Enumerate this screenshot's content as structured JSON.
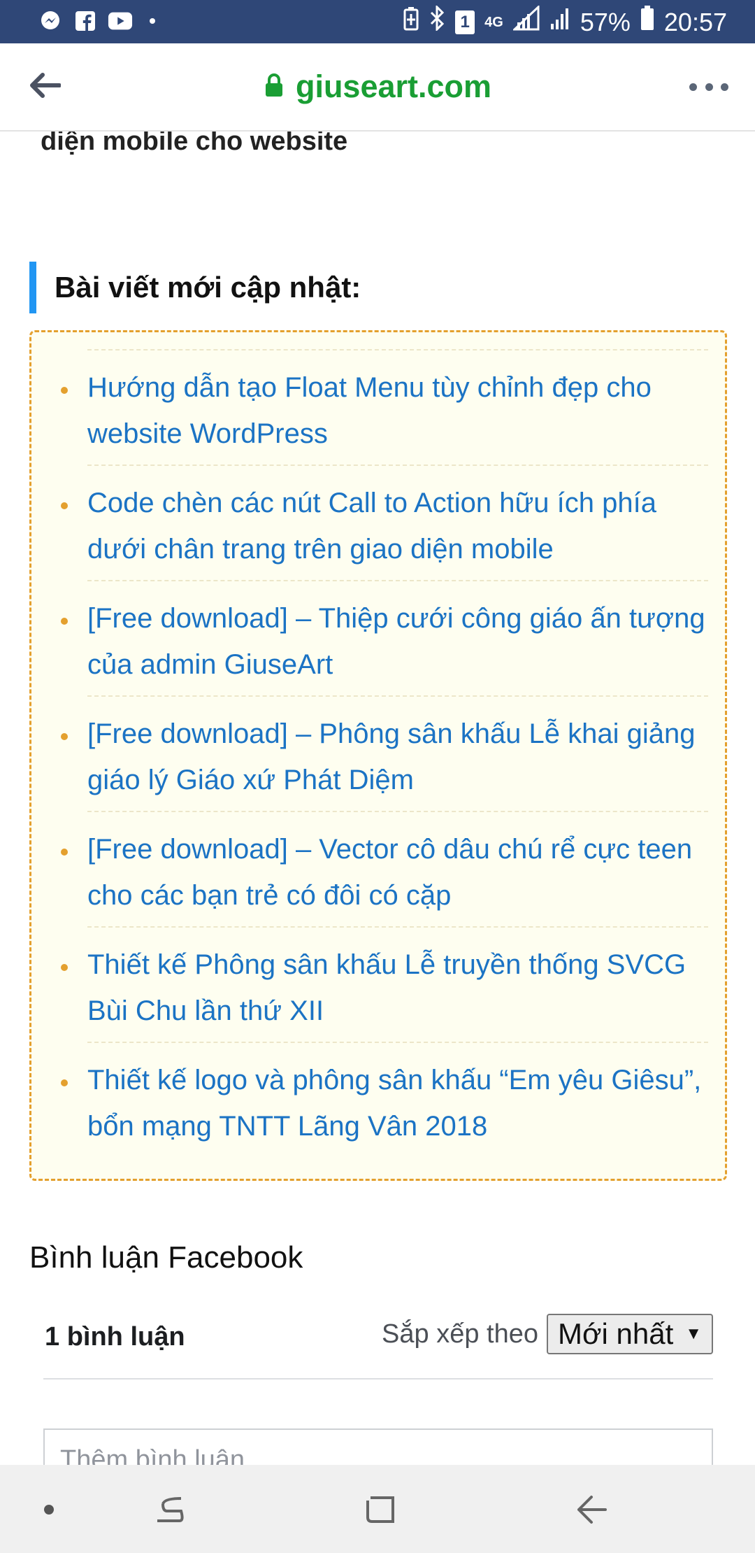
{
  "status_bar": {
    "battery_percent": "57%",
    "time": "20:57",
    "network": "4G",
    "sim_slot": "1",
    "left_icons": [
      "messenger-icon",
      "facebook-icon",
      "youtube-icon",
      "notification-dot"
    ],
    "right_icons": [
      "battery-saver-icon",
      "bluetooth-icon",
      "sim-icon",
      "signal-icon",
      "signal-icon-2",
      "battery-icon"
    ]
  },
  "browser": {
    "url": "giuseart.com",
    "back_icon": "arrow-left-icon",
    "lock_icon": "lock-icon",
    "menu_icon": "more-dots-icon"
  },
  "article": {
    "previous_title": "diện mobile cho website",
    "updates_heading": "Bài viết mới cập nhật:",
    "updates": [
      {
        "title": "Hướng dẫn tạo Float Menu tùy chỉnh đẹp cho website WordPress"
      },
      {
        "title": "Code chèn các nút Call to Action hữu ích phía dưới chân trang trên giao diện mobile"
      },
      {
        "title": "[Free download] – Thiệp cưới công giáo ấn tượng của admin GiuseArt"
      },
      {
        "title": "[Free download] – Phông sân khấu Lễ khai giảng giáo lý Giáo xứ Phát Diệm"
      },
      {
        "title": "[Free download] – Vector cô dâu chú rể cực teen cho các bạn trẻ có đôi có cặp"
      },
      {
        "title": "Thiết kế Phông sân khấu Lễ truyền thống SVCG Bùi Chu lần thứ XII"
      },
      {
        "title": "Thiết kế logo và phông sân khấu “Em yêu Giêsu”, bổn mạng TNTT Lãng Vân 2018"
      }
    ]
  },
  "facebook_comments": {
    "title": "Bình luận Facebook",
    "count_label": "1 bình luận",
    "sort_label": "Sắp xếp theo",
    "sort_selected": "Mới nhất",
    "comment_placeholder": "Thêm bình luận..."
  },
  "nav_bar": {
    "icons": [
      "dot-icon",
      "recent-apps-icon",
      "home-icon",
      "back-icon"
    ]
  },
  "colors": {
    "status_bar": "#2f4777",
    "url_green": "#1a9e34",
    "link_blue": "#1b73c4",
    "accent_blue": "#2196f3",
    "box_border": "#e4a02e",
    "box_background": "#fefef0"
  }
}
